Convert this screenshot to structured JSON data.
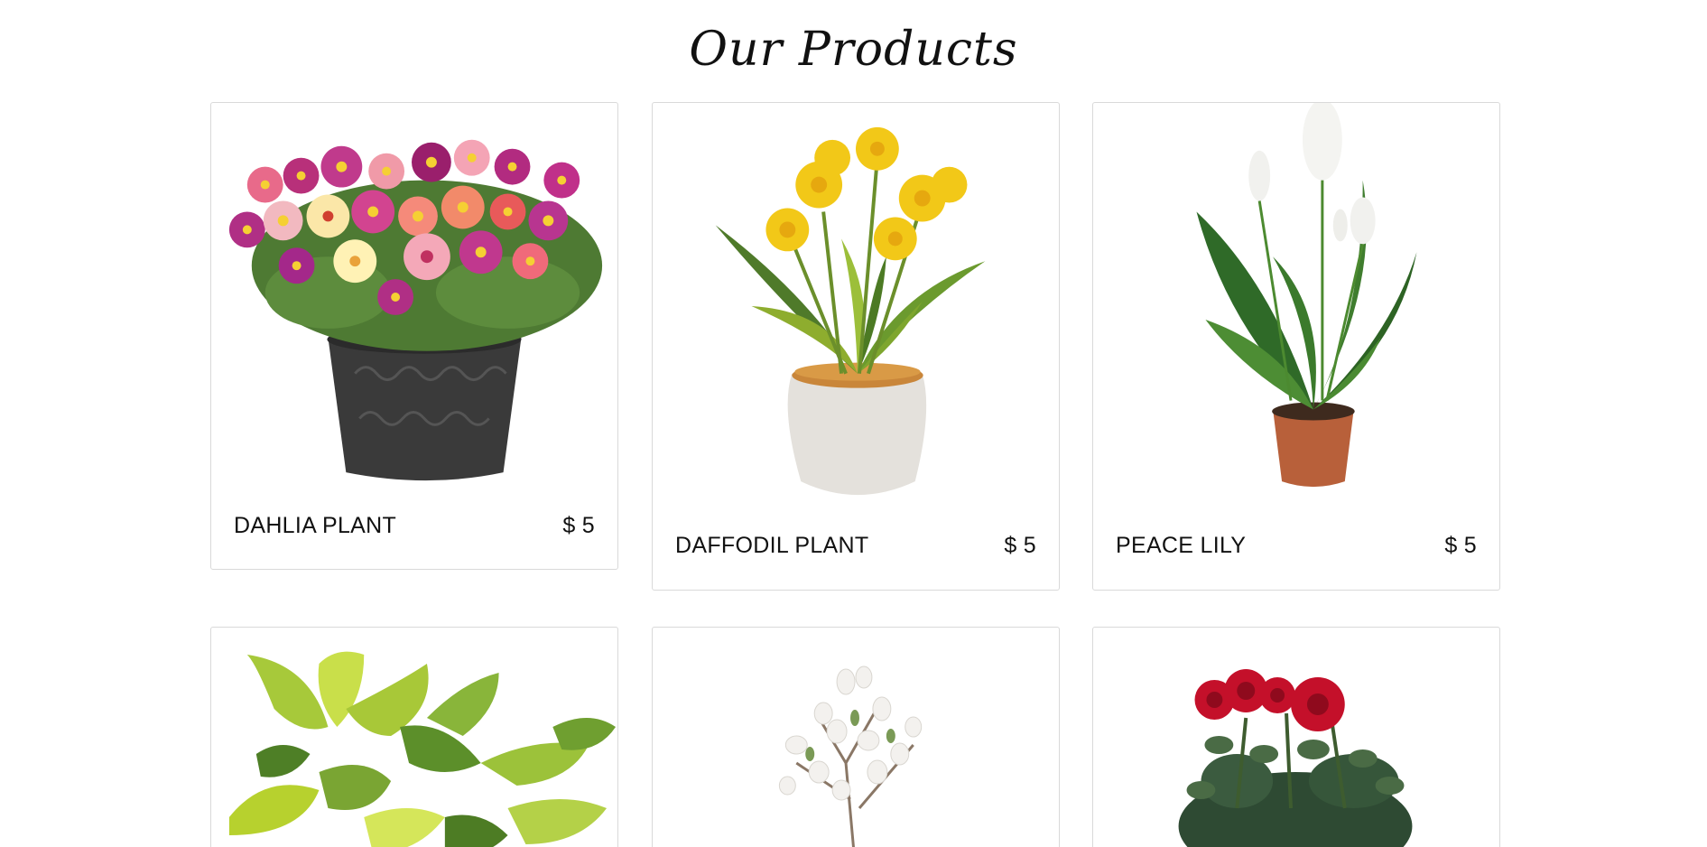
{
  "section": {
    "title": "Our Products"
  },
  "products": [
    {
      "name": "DAHLIA PLANT",
      "price": "$ 5",
      "image_icon": "dahlia-plant-image"
    },
    {
      "name": "DAFFODIL PLANT",
      "price": "$ 5",
      "image_icon": "daffodil-plant-image"
    },
    {
      "name": "PEACE LILY",
      "price": "$ 5",
      "image_icon": "peace-lily-image"
    },
    {
      "name": "",
      "price": "",
      "image_icon": "money-plant-image"
    },
    {
      "name": "",
      "price": "",
      "image_icon": "magnolia-branch-image"
    },
    {
      "name": "",
      "price": "",
      "image_icon": "red-rose-plant-image"
    }
  ],
  "colors": {
    "background": "#ffffff",
    "card_border": "#d9d9d9",
    "text": "#111111"
  }
}
